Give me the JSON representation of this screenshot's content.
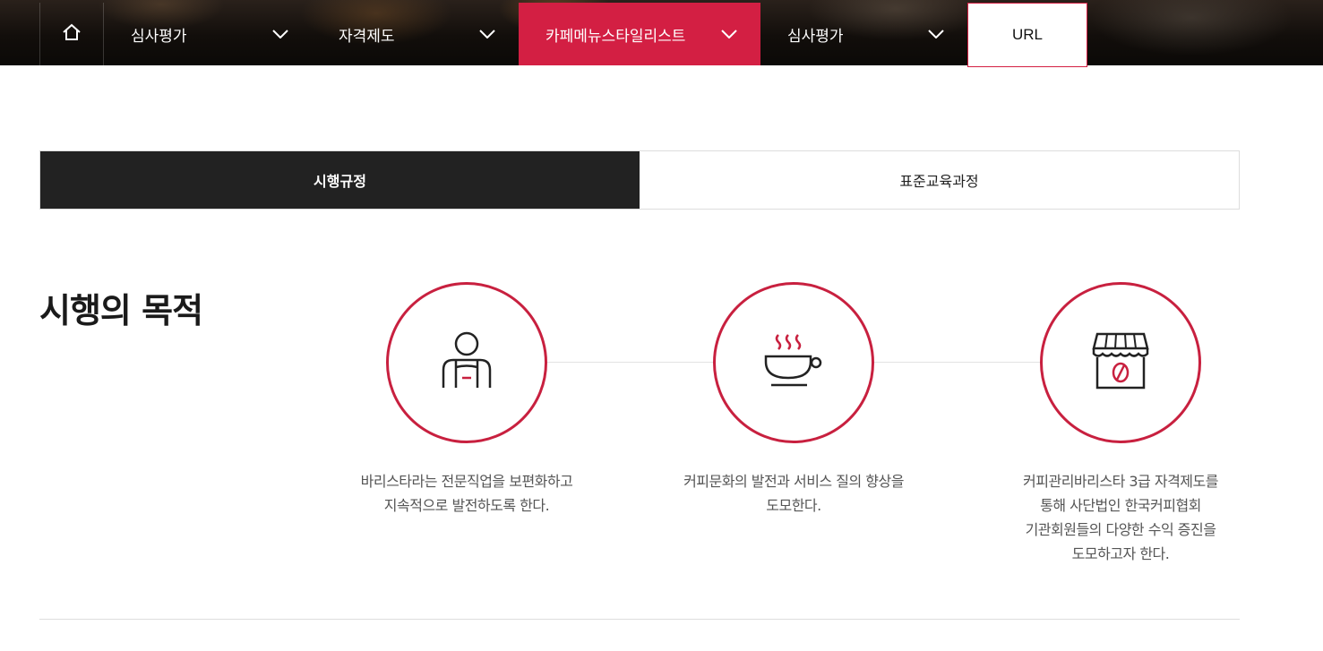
{
  "nav": {
    "home_icon": "home-icon",
    "items": [
      {
        "label": "심사평가",
        "icon": "chevron-down-icon",
        "active": false
      },
      {
        "label": "자격제도",
        "icon": "chevron-down-icon",
        "active": false
      },
      {
        "label": "카페메뉴스타일리스트",
        "icon": "chevron-down-icon",
        "active": true
      },
      {
        "label": "심사평가",
        "icon": "chevron-down-icon",
        "active": false
      }
    ],
    "url_label": "URL",
    "accent_color": "#d31f43"
  },
  "tabs": [
    {
      "label": "시행규정",
      "active": true
    },
    {
      "label": "표준교육과정",
      "active": false
    }
  ],
  "purpose": {
    "title": "시행의 목적",
    "items": [
      {
        "icon": "barista-icon",
        "lines": [
          "바리스타라는 전문직업을 보편화하고",
          "지속적으로 발전하도록 한다."
        ]
      },
      {
        "icon": "coffee-cup-icon",
        "lines": [
          "커피문화의 발전과 서비스 질의 향상을",
          "도모한다."
        ]
      },
      {
        "icon": "coffee-shop-icon",
        "lines": [
          "커피관리바리스타 3급 자격제도를",
          "통해 사단법인 한국커피협회",
          "기관회원들의 다양한 수익 증진을",
          "도모하고자 한다."
        ]
      }
    ],
    "circle_color": "#c8203f"
  }
}
